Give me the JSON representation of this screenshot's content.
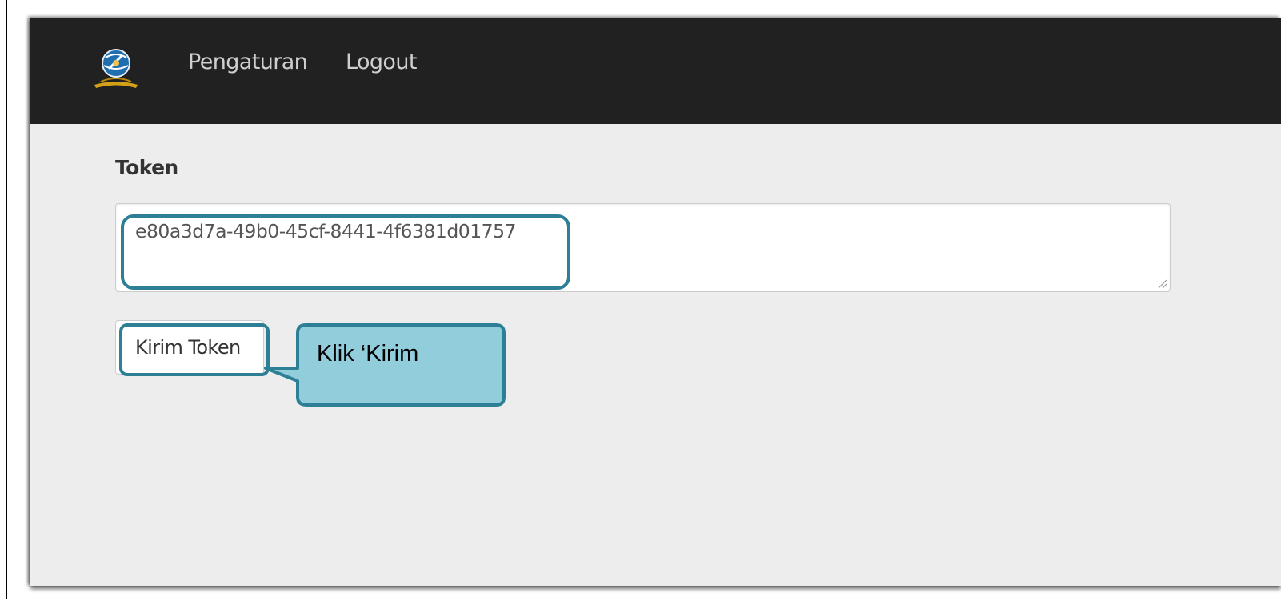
{
  "navbar": {
    "logo_icon": "emblem-logo-icon",
    "links": [
      {
        "label": "Pengaturan"
      },
      {
        "label": "Logout"
      }
    ],
    "background": "#212121"
  },
  "form": {
    "label": "Token",
    "token_value": "e80a3d7a-49b0-45cf-8441-4f6381d01757",
    "submit_label": "Kirim Token"
  },
  "annotation": {
    "callout_text": "Klik ‘Kirim",
    "highlight_color": "#2d7f96",
    "callout_fill": "#92cddc"
  }
}
